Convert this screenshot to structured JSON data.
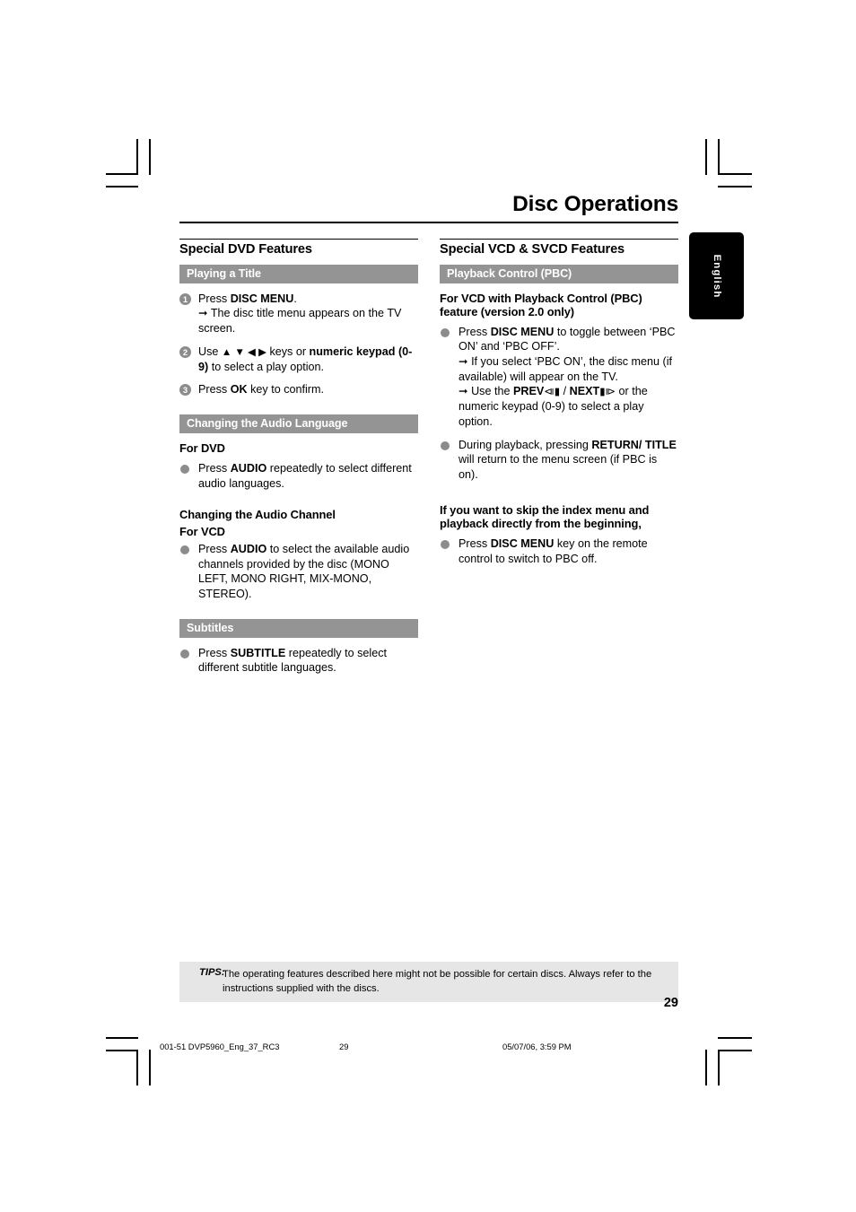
{
  "header": {
    "doc_title": "Disc Operations",
    "language_tab": "English"
  },
  "left_column": {
    "title": "Special DVD Features",
    "section1": {
      "bar": "Playing a Title",
      "steps": [
        {
          "num": "1",
          "line1_pre": "Press ",
          "line1_bold": "DISC MENU",
          "line1_post": ".",
          "arrow_text": "The disc title menu appears on the TV screen."
        },
        {
          "num": "2",
          "pre": "Use ",
          "keys": "▲ ▼ ◀ ▶",
          "mid": " keys or ",
          "bold1": "numeric keypad (0-9)",
          "post": " to select a play option."
        },
        {
          "num": "3",
          "pre": "Press ",
          "bold1": "OK",
          "post": " key to confirm."
        }
      ]
    },
    "section2": {
      "bar": "Changing the Audio Language",
      "sub1": "For DVD",
      "bullet1_pre": "Press ",
      "bullet1_bold": "AUDIO",
      "bullet1_post": " repeatedly to select different audio languages.",
      "sub2": "Changing the Audio Channel",
      "sub3": "For VCD",
      "bullet2_pre": "Press ",
      "bullet2_bold": "AUDIO",
      "bullet2_post": " to select the available audio channels provided by the disc (MONO LEFT, MONO RIGHT, MIX-MONO, STEREO)."
    },
    "section3": {
      "bar": "Subtitles",
      "bullet_pre": "Press ",
      "bullet_bold": "SUBTITLE",
      "bullet_post": " repeatedly to select different subtitle languages."
    }
  },
  "right_column": {
    "title": "Special VCD & SVCD Features",
    "section1": {
      "bar": "Playback Control (PBC)",
      "sub1": "For VCD with Playback Control (PBC) feature (version 2.0 only)",
      "bullet1_pre": "Press ",
      "bullet1_bold": "DISC MENU",
      "bullet1_post": " to toggle between ‘PBC ON’ and ‘PBC OFF’.",
      "bullet1_arrow1": "If you select ‘PBC ON’, the disc menu (if available) will appear on the TV.",
      "bullet1_arrow2_pre": "Use the ",
      "bullet1_arrow2_bold1": "PREV",
      "bullet1_arrow2_sym1": "⧏▮",
      "bullet1_arrow2_mid": " / ",
      "bullet1_arrow2_bold2": "NEXT",
      "bullet1_arrow2_sym2": "▮⧐",
      "bullet1_arrow2_post": " or the numeric keypad (0-9) to select a play option.",
      "bullet2_pre": "During playback, pressing ",
      "bullet2_bold": "RETURN/ TITLE",
      "bullet2_post": " will return to the menu screen (if PBC is on).",
      "sub2": "If you want to skip the index menu and playback directly from the beginning,",
      "bullet3_pre": "Press ",
      "bullet3_bold": "DISC MENU",
      "bullet3_post": " key on the remote control to switch to PBC off."
    }
  },
  "footer": {
    "tips_label": "TIPS:",
    "tips_text": "The operating features described here might not be possible for certain discs.   Always refer to the instructions supplied with the discs.",
    "page_number": "29"
  },
  "print_strip": {
    "file": "001-51 DVP5960_Eng_37_RC3",
    "page": "29",
    "date": "05/07/06, 3:59 PM"
  },
  "colors": {
    "bar_gray": "#949494",
    "bullet_gray": "#8c8c8c",
    "tips_bg": "#e6e6e6",
    "tab_black": "#000000"
  }
}
